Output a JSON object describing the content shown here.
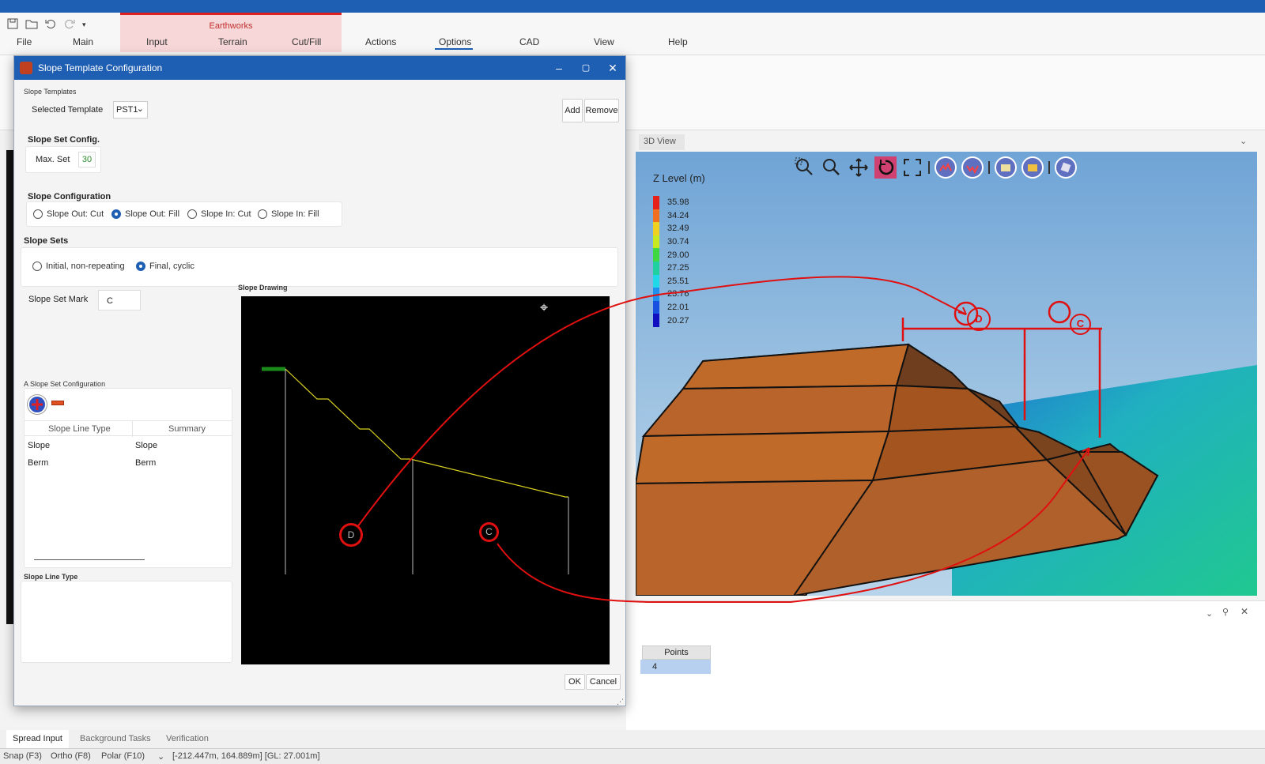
{
  "ribbon": {
    "tabs": [
      "File",
      "Main",
      "Input",
      "Terrain",
      "Cut/Fill",
      "Actions",
      "Options",
      "CAD",
      "View",
      "Help"
    ],
    "context_group": "Earthworks",
    "active_tab": "Options"
  },
  "dialog": {
    "title": "Slope Template Configuration",
    "slope_templates_caption": "Slope Templates",
    "selected_template_label": "Selected Template",
    "selected_template_value": "PST1",
    "add_label": "Add",
    "remove_label": "Remove",
    "slope_set_config_title": "Slope Set Config.",
    "max_set_label": "Max. Set",
    "max_set_value": "30",
    "slope_configuration_title": "Slope Configuration",
    "slope_config_options": [
      "Slope Out: Cut",
      "Slope Out: Fill",
      "Slope In: Cut",
      "Slope In: Fill"
    ],
    "slope_config_selected": 1,
    "slope_sets_title": "Slope Sets",
    "slope_sets_options": [
      "Initial, non-repeating",
      "Final, cyclic"
    ],
    "slope_sets_selected": 1,
    "slope_set_mark_label": "Slope Set Mark",
    "slope_set_mark_value": "C",
    "slope_drawing_caption": "Slope Drawing",
    "a_slope_set_config_caption": "A Slope Set Configuration",
    "table_headers": [
      "Slope Line Type",
      "Summary"
    ],
    "table_rows": [
      [
        "Slope",
        "Slope"
      ],
      [
        "Berm",
        "Berm"
      ]
    ],
    "slope_line_type_caption": "Slope Line Type",
    "ok_label": "OK",
    "cancel_label": "Cancel",
    "drawing_markers": [
      "D",
      "C"
    ]
  },
  "view3d": {
    "tab_label": "3D View",
    "legend_title": "Z Level (m)",
    "legend_values": [
      "35.98",
      "34.24",
      "32.49",
      "30.74",
      "29.00",
      "27.25",
      "25.51",
      "23.76",
      "22.01",
      "20.27"
    ],
    "legend_colors": [
      "#e8201c",
      "#f07020",
      "#f0d020",
      "#c8e820",
      "#40d840",
      "#20d0a0",
      "#20d8e8",
      "#2090f0",
      "#1850e0",
      "#1010c0"
    ],
    "annotation_markers": [
      "D",
      "C"
    ]
  },
  "lower_panel": {
    "points_header": "Points",
    "points_value": "4"
  },
  "bottom_tabs": [
    "Spread Input",
    "Background Tasks",
    "Verification"
  ],
  "status": {
    "snap": "Snap (F3)",
    "ortho": "Ortho (F8)",
    "polar": "Polar (F10)",
    "coords": "[-212.447m, 164.889m] [GL: 27.001m]"
  }
}
